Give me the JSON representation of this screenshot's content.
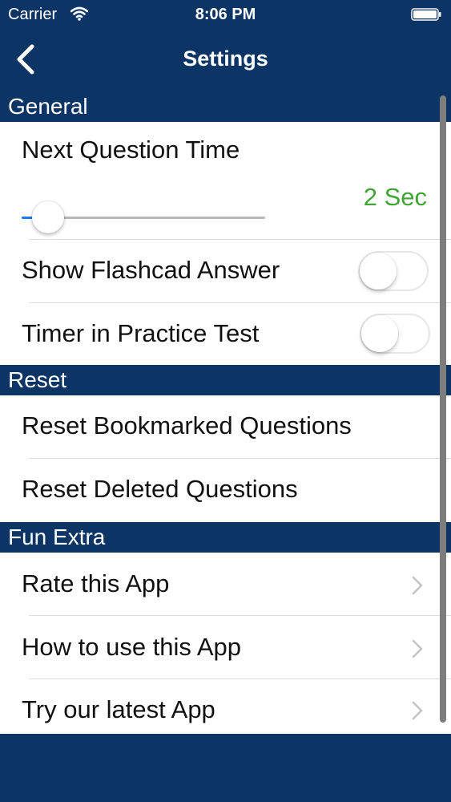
{
  "status_bar": {
    "carrier": "Carrier",
    "time": "8:06 PM",
    "wifi_icon": "wifi-icon",
    "battery_icon": "battery-icon"
  },
  "nav": {
    "title": "Settings",
    "back_icon": "chevron-left-icon"
  },
  "sections": {
    "general": {
      "header": "General",
      "next_question_time": {
        "label": "Next Question Time",
        "value_text": "2 Sec",
        "slider_fraction": 0.05
      },
      "show_flashcard_answer": {
        "label": "Show Flashcad Answer",
        "on": false
      },
      "timer_in_practice_test": {
        "label": "Timer in Practice Test",
        "on": false
      }
    },
    "reset": {
      "header": "Reset",
      "items": [
        {
          "label": "Reset Bookmarked Questions"
        },
        {
          "label": "Reset Deleted Questions"
        }
      ]
    },
    "fun_extra": {
      "header": "Fun Extra",
      "items": [
        {
          "label": "Rate this App",
          "icon": "chevron-right-icon"
        },
        {
          "label": "How to use this App",
          "icon": "chevron-right-icon"
        },
        {
          "label": "Try our latest App",
          "icon": "chevron-right-icon"
        }
      ]
    }
  },
  "colors": {
    "navy": "#0c3566",
    "slider_value_green": "#3fa535",
    "slider_blue": "#1a7cf2"
  }
}
